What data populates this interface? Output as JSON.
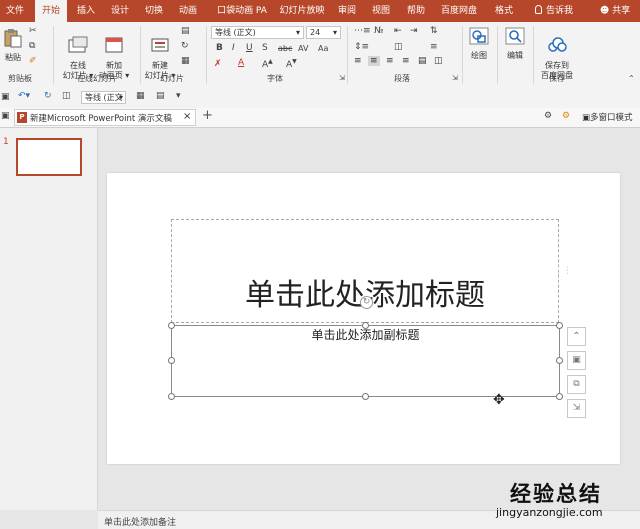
{
  "tabs": [
    "文件",
    "开始",
    "插入",
    "设计",
    "切换",
    "动画",
    "口袋动画 PA",
    "幻灯片放映",
    "审阅",
    "视图",
    "帮助",
    "百度网盘",
    "格式"
  ],
  "tell_me": "告诉我",
  "share": "共享",
  "ribbon": {
    "paste": "粘贴",
    "online_slides": "在线\n幻灯片 ▾",
    "new_animation_page": "新加\n动画页 ▾",
    "new_slide": "新建\n幻灯片 ▾",
    "font_name": "等线 (正文)",
    "font_size": "24",
    "draw": "绘图",
    "edit": "编辑",
    "save_to_baidu": "保存到\n百度网盘",
    "groups": {
      "clipboard": "剪贴板",
      "online_slides": "在线幻灯片",
      "slides": "幻灯片",
      "font": "字体",
      "paragraph": "段落",
      "save": "保存"
    }
  },
  "qat": {
    "font_box": "等线 (正文"
  },
  "doc_tab": {
    "title": "新建Microsoft PowerPoint 演示文稿",
    "close": "×",
    "add": "+",
    "multi_window": "多窗口模式"
  },
  "thumbnails": [
    {
      "number": "1"
    }
  ],
  "slide": {
    "title_placeholder": "单击此处添加标题",
    "subtitle_placeholder": "单击此处添加副标题"
  },
  "notes_placeholder": "单击此处添加备注",
  "watermark": {
    "brand": "经验总结",
    "url": "jingyanzongjie.com"
  },
  "colors": {
    "accent": "#b7472a",
    "ribbon_bg": "#f3f3f3",
    "canvas_bg": "#e6e6e6"
  }
}
